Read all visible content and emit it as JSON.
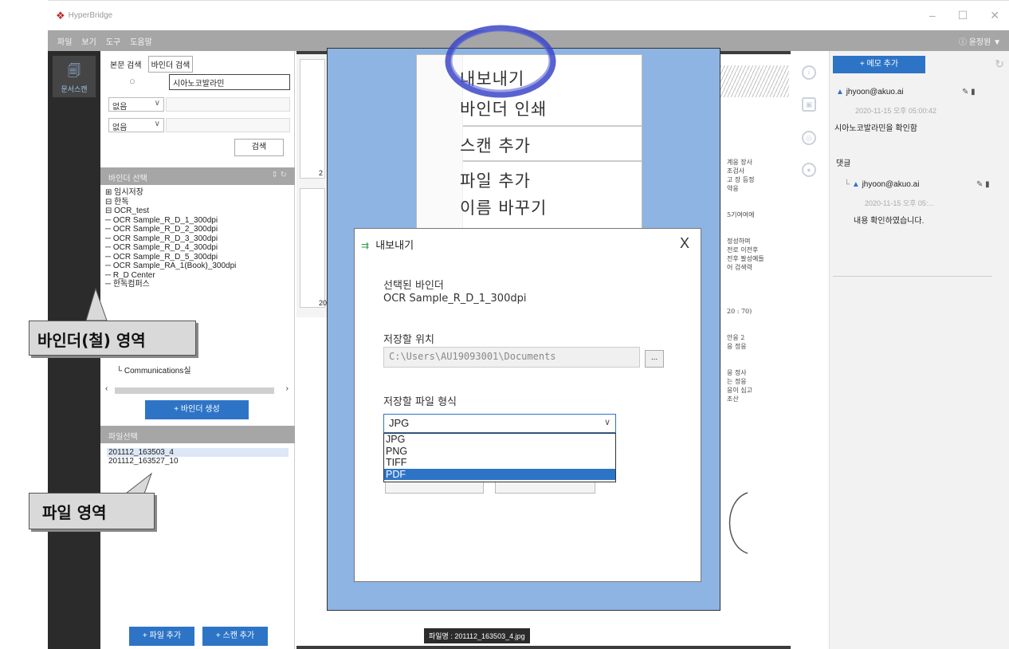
{
  "app": {
    "title": "HyperBridge"
  },
  "window_controls": {
    "minimize": "–",
    "maximize": "☐",
    "close": "✕"
  },
  "menubar": {
    "items": [
      "파일",
      "보기",
      "도구",
      "도움말"
    ],
    "user": "ⓘ 윤정원 ▼"
  },
  "left_strip": {
    "active_label": "문서스캔"
  },
  "search_panel": {
    "tabs": [
      "본문 검색",
      "바인더 검색"
    ],
    "query": "시아노코발라민",
    "filter1": "없음",
    "filter2": "없음",
    "search_button": "검색"
  },
  "binder_section": {
    "header": "바인더 선택",
    "tree": [
      "⊞ 임시저장",
      "⊟ 한독",
      "   ⊟ OCR_test",
      "      ─ OCR Sample_R_D_1_300dpi",
      "      ─ OCR Sample_R_D_2_300dpi",
      "      ─ OCR Sample_R_D_3_300dpi",
      "      ─ OCR Sample_R_D_4_300dpi",
      "      ─ OCR Sample_R_D_5_300dpi",
      "      ─ OCR Sample_RA_1(Book)_300dpi",
      "   ─ R_D Center",
      "   ─ 한독컴퍼스"
    ],
    "tree_tail": "└ Communications실",
    "create_button": "+ 바인더 생성"
  },
  "file_section": {
    "header": "파일선택",
    "files": [
      "201112_163503_4",
      "201112_163527_10"
    ],
    "add_file_button": "+ 파일 추가",
    "add_scan_button": "+ 스캔 추가"
  },
  "callouts": {
    "binder": "바인더(철) 영역",
    "file": "파일 영역"
  },
  "viewer": {
    "thumb_numbers": [
      "2",
      "20"
    ],
    "handwriting_lines": [
      "계응 장사",
      "조검사",
      "고 장 등정",
      "약응",
      "",
      "",
      "5기여여에",
      "",
      "",
      "정성하며",
      "전로 이전후",
      "전후 팔성예들",
      "어 검색력",
      "",
      "",
      "",
      "",
      "20 : 70)",
      "",
      "",
      "안응 2",
      "응 정응",
      "",
      "",
      "응 정사",
      "는 정응",
      "응이 심고",
      "조산"
    ],
    "filename": "파일명 : 201112_163503_4.jpg"
  },
  "context_menu": {
    "items": [
      "내보내기",
      "바인더 인쇄",
      "스캔 추가",
      "파일 추가",
      "이름 바꾸기"
    ]
  },
  "export_dialog": {
    "title": "내보내기",
    "close": "X",
    "selected_binder_label": "선택된 바인더",
    "selected_binder_value": "OCR Sample_R_D_1_300dpi",
    "location_label": "저장할 위치",
    "location_value": "C:\\Users\\AU19093001\\Documents",
    "browse_button": "...",
    "format_label": "저장할 파일 형식",
    "format_value": "JPG",
    "format_options": [
      "JPG",
      "PNG",
      "TIFF",
      "PDF"
    ],
    "highlighted_option": "PDF"
  },
  "memo_panel": {
    "add_button": "+ 메모 추가",
    "memo_user": "jhyoon@akuo.ai",
    "memo_time": "2020-11-15 오후 05:00:42",
    "memo_text": "시아노코발라민을 확인함",
    "comment_header": "댓글",
    "comment_user": "jhyoon@akuo.ai",
    "comment_time": "2020-11-15 오후 05:...",
    "comment_text": "내용 확인하였습니다."
  },
  "colors": {
    "accent": "#2e74c6",
    "highlight_panel": "#8db4e2",
    "menubar": "#a6a6a6",
    "sidebar": "#2b2b2b",
    "circle": "#3b46c8"
  }
}
